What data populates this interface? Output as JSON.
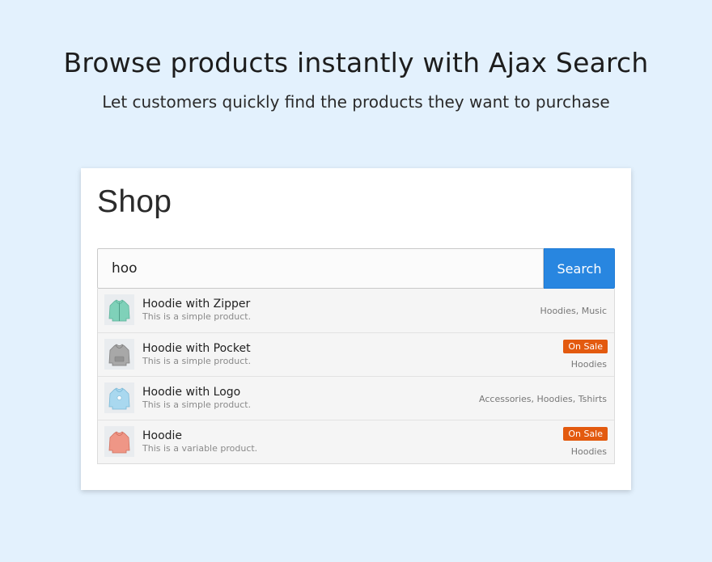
{
  "hero": {
    "title": "Browse products instantly with Ajax Search",
    "subtitle": "Let customers quickly find the products they want to purchase"
  },
  "shop": {
    "title": "Shop",
    "search": {
      "value": "hoo",
      "button_label": "Search"
    },
    "results": [
      {
        "name": "Hoodie with Zipper",
        "description": "This is a simple product.",
        "categories": "Hoodies, Music",
        "on_sale": false,
        "thumb_icon": "hoodie-zipper-icon",
        "thumb_color": "#7fd1b9"
      },
      {
        "name": "Hoodie with Pocket",
        "description": "This is a simple product.",
        "categories": "Hoodies",
        "on_sale": true,
        "sale_label": "On Sale",
        "thumb_icon": "hoodie-pocket-icon",
        "thumb_color": "#9a9a9a"
      },
      {
        "name": "Hoodie with Logo",
        "description": "This is a simple product.",
        "categories": "Accessories, Hoodies, Tshirts",
        "on_sale": false,
        "thumb_icon": "hoodie-logo-icon",
        "thumb_color": "#9ed0ea"
      },
      {
        "name": "Hoodie",
        "description": "This is a variable product.",
        "categories": "Hoodies",
        "on_sale": true,
        "sale_label": "On Sale",
        "thumb_icon": "hoodie-icon",
        "thumb_color": "#ee8f80"
      }
    ]
  },
  "colors": {
    "page_background": "#e3f1fd",
    "search_button": "#2886e0",
    "sale_badge": "#e35a0f"
  }
}
